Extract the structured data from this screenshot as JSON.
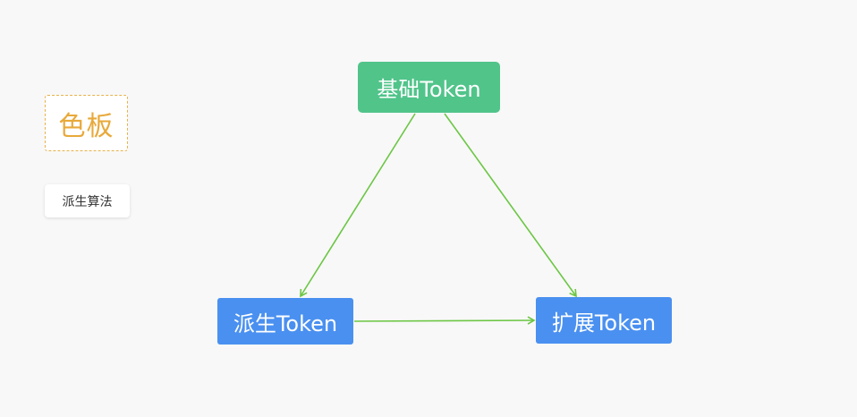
{
  "sidebar": {
    "palette_label": "色板",
    "derive_algorithm_label": "派生算法"
  },
  "diagram": {
    "nodes": {
      "base": "基础Token",
      "derived": "派生Token",
      "extended": "扩展Token"
    },
    "edges": [
      {
        "from": "base",
        "to": "derived"
      },
      {
        "from": "base",
        "to": "extended"
      },
      {
        "from": "derived",
        "to": "extended"
      }
    ],
    "colors": {
      "base_node": "#51c48a",
      "derived_node": "#4a90f0",
      "extended_node": "#4a90f0",
      "edge": "#6cc644",
      "palette_accent": "#e8a93a"
    }
  }
}
